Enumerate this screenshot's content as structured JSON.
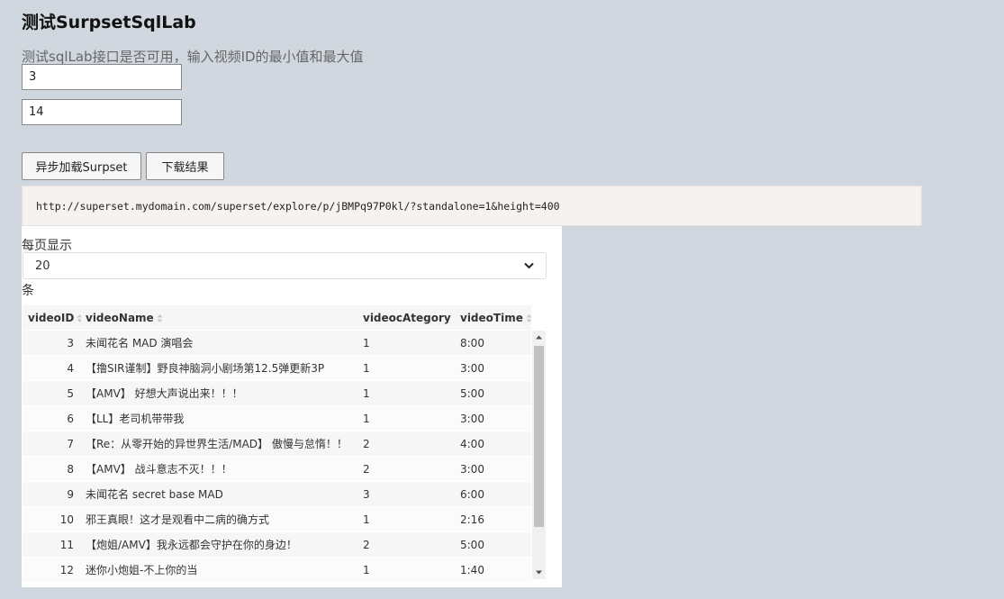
{
  "page": {
    "title": "测试SurpsetSqlLab",
    "subtitle": "测试sqlLab接口是否可用，输入视频ID的最小值和最大值"
  },
  "inputs": {
    "min_value": "3",
    "max_value": "14"
  },
  "buttons": {
    "load": "异步加载Surpset",
    "download": "下载结果"
  },
  "result_url": "http://superset.mydomain.com/superset/explore/p/jBMPq97P0kl/?standalone=1&height=400",
  "table": {
    "page_size_label": "每页显示",
    "page_size_selected": "20",
    "page_size_unit": "条",
    "columns": [
      "videoID",
      "videoName",
      "videocAtegory",
      "videoTime"
    ],
    "rows": [
      {
        "id": "3",
        "name": "未闻花名 MAD 演唱会",
        "category": "1",
        "time": "8:00"
      },
      {
        "id": "4",
        "name": "【撸SIR谨制】野良神脑洞小剧场第12.5弹更新3P",
        "category": "1",
        "time": "3:00"
      },
      {
        "id": "5",
        "name": "【AMV】 好想大声说出来！！！",
        "category": "1",
        "time": "5:00"
      },
      {
        "id": "6",
        "name": "【LL】老司机带带我",
        "category": "1",
        "time": "3:00"
      },
      {
        "id": "7",
        "name": "【Re：从零开始的异世界生活/MAD】 傲慢与怠惰！！",
        "category": "2",
        "time": "4:00"
      },
      {
        "id": "8",
        "name": "【AMV】 战斗意志不灭！！！",
        "category": "2",
        "time": "3:00"
      },
      {
        "id": "9",
        "name": "未闻花名 secret base MAD",
        "category": "3",
        "time": "6:00"
      },
      {
        "id": "10",
        "name": "邪王真眼！这才是观看中二病的确方式",
        "category": "1",
        "time": "2:16"
      },
      {
        "id": "11",
        "name": "【炮姐/AMV】我永远都会守护在你的身边！",
        "category": "2",
        "time": "5:00"
      },
      {
        "id": "12",
        "name": "迷你小炮姐-不上你的当",
        "category": "1",
        "time": "1:40"
      }
    ]
  },
  "icons": {
    "sort": "sort-both-icon",
    "select_caret": "chevron-down-icon",
    "scroll_up": "scroll-up-arrow-icon",
    "scroll_down": "scroll-down-arrow-icon"
  },
  "colors": {
    "background": "#d0d7de",
    "code_background": "#f6f2ef",
    "panel": "#ffffff"
  }
}
